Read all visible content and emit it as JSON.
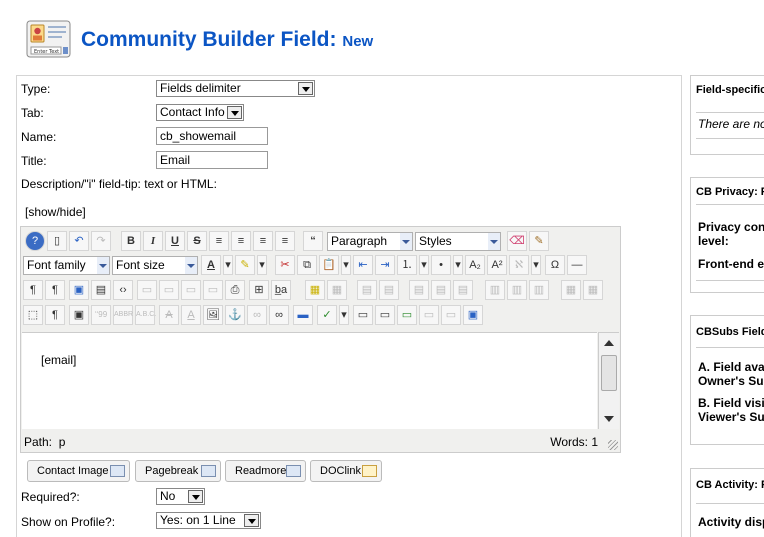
{
  "header": {
    "title": "Community Builder Field:",
    "subtitle": "New",
    "icon": "field-edit-icon",
    "icon_text": "Enter Text"
  },
  "form": {
    "type": {
      "label": "Type:",
      "value": "Fields delimiter"
    },
    "tab": {
      "label": "Tab:",
      "value": "Contact Info"
    },
    "name": {
      "label": "Name:",
      "value": "cb_showemail"
    },
    "title": {
      "label": "Title:",
      "value": "Email"
    },
    "description": {
      "label": "Description/\"i\" field-tip: text or HTML:",
      "toggle": "[show/hide]"
    },
    "required": {
      "label": "Required?:",
      "value": "No"
    },
    "show_on_profile": {
      "label": "Show on Profile?:",
      "value": "Yes: on 1 Line"
    }
  },
  "editor": {
    "format_select": "Paragraph",
    "styles_select": "Styles",
    "font_family_select": "Font family",
    "font_size_select": "Font size",
    "content": "[email]",
    "path_label": "Path:",
    "path_value": "p",
    "words": "Words: 1"
  },
  "editor_buttons": [
    {
      "label": "Contact Image"
    },
    {
      "label": "Pagebreak"
    },
    {
      "label": "Readmore"
    },
    {
      "label": "DOClink"
    }
  ],
  "right_panels": {
    "field_specific": {
      "title": "Field-specific",
      "note": "There are no"
    },
    "cb_privacy": {
      "title": "CB Privacy: F",
      "item1": [
        "Privacy con",
        "level:"
      ],
      "item2": "Front-end e"
    },
    "cbsubs": {
      "title": "CBSubs Field",
      "item1": [
        "A. Field ava",
        "Owner's Su"
      ],
      "item2": [
        "B. Field visi",
        "Viewer's Su"
      ]
    },
    "cb_activity": {
      "title": "CB Activity: F",
      "item1": "Activity disp"
    }
  },
  "colors": {
    "title": "#0b55c4",
    "border": "#cccccc",
    "toolbar_bg": "#f0f0ee"
  }
}
